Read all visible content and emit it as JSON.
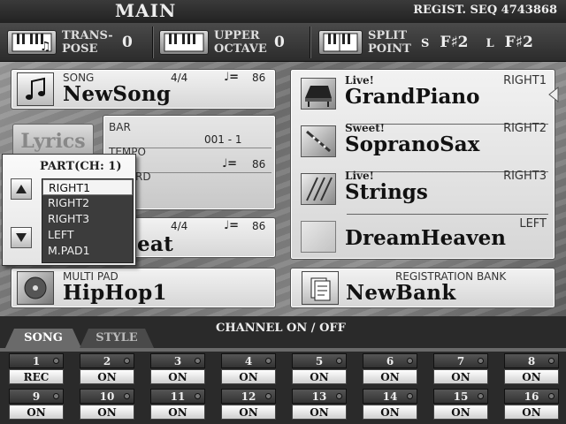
{
  "header": {
    "title": "MAIN",
    "regist_seq": "REGIST. SEQ 4743868"
  },
  "top": {
    "transpose": {
      "label1": "TRANS-",
      "label2": "POSE",
      "value": "0"
    },
    "upper_octave": {
      "label1": "UPPER",
      "label2": "OCTAVE",
      "value": "0"
    },
    "split_point": {
      "label1": "SPLIT",
      "label2": "POINT",
      "s_label": "S",
      "s_value": "F♯2",
      "l_label": "L",
      "l_value": "F♯2"
    }
  },
  "song": {
    "label": "SONG",
    "meter": "4/4",
    "tempo_symbol": "♩=",
    "tempo": "86",
    "name": "NewSong"
  },
  "lyrics_button": "Lyrics",
  "info": {
    "bar_label": "BAR",
    "bar_value": "001 -   1",
    "tempo_label": "TEMPO",
    "tempo_symbol": "♩=",
    "tempo_value": "86",
    "chord_label": "RD"
  },
  "style": {
    "meter": "4/4",
    "tempo_symbol": "♩=",
    "tempo": "86",
    "name_fragment": "eat"
  },
  "multipad": {
    "label": "MULTI PAD",
    "name": "HipHop1"
  },
  "voices": [
    {
      "prefix": "Live!",
      "name": "GrandPiano",
      "part": "RIGHT1"
    },
    {
      "prefix": "Sweet!",
      "name": "SopranoSax",
      "part": "RIGHT2"
    },
    {
      "prefix": "Live!",
      "name": "Strings",
      "part": "RIGHT3"
    },
    {
      "prefix": "",
      "name": "DreamHeaven",
      "part": "LEFT"
    }
  ],
  "registration": {
    "label": "REGISTRATION BANK",
    "name": "NewBank"
  },
  "part_popup": {
    "title": "PART(CH:  1)",
    "items": [
      "RIGHT1",
      "RIGHT2",
      "RIGHT3",
      "LEFT",
      "M.PAD1"
    ],
    "selected": "RIGHT1"
  },
  "channel": {
    "title": "CHANNEL ON / OFF",
    "tabs": [
      "SONG",
      "STYLE"
    ],
    "active_tab": "SONG",
    "channels": [
      {
        "n": "1",
        "s": "REC"
      },
      {
        "n": "2",
        "s": "ON"
      },
      {
        "n": "3",
        "s": "ON"
      },
      {
        "n": "4",
        "s": "ON"
      },
      {
        "n": "5",
        "s": "ON"
      },
      {
        "n": "6",
        "s": "ON"
      },
      {
        "n": "7",
        "s": "ON"
      },
      {
        "n": "8",
        "s": "ON"
      },
      {
        "n": "9",
        "s": "ON"
      },
      {
        "n": "10",
        "s": "ON"
      },
      {
        "n": "11",
        "s": "ON"
      },
      {
        "n": "12",
        "s": "ON"
      },
      {
        "n": "13",
        "s": "ON"
      },
      {
        "n": "14",
        "s": "ON"
      },
      {
        "n": "15",
        "s": "ON"
      },
      {
        "n": "16",
        "s": "ON"
      }
    ]
  },
  "icons": [
    "keyboard-transpose-icon",
    "keyboard-octave-icon",
    "keyboard-split-icon",
    "music-note-icon",
    "piano-icon",
    "sax-icon",
    "strings-icon",
    "pad-icon",
    "cd-icon",
    "registration-icon",
    "up-arrow-icon",
    "down-arrow-icon"
  ]
}
